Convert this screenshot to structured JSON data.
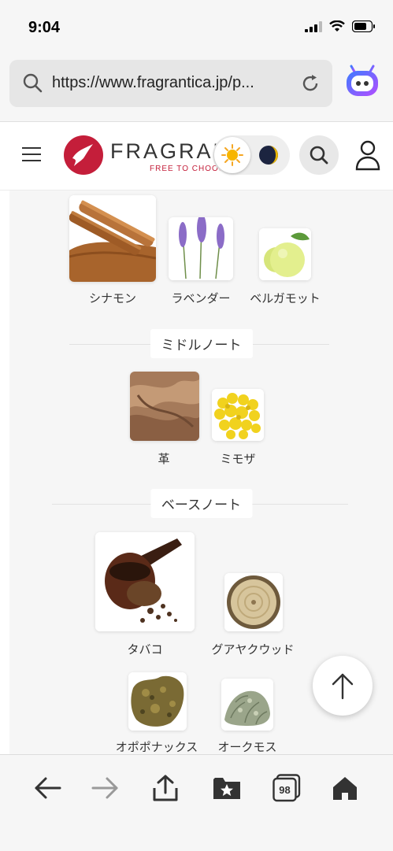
{
  "status_bar": {
    "time": "9:04"
  },
  "browser": {
    "url": "https://www.fragrantica.jp/p..."
  },
  "site": {
    "logo_text": "FRAGRANTICA",
    "tagline": "FREE TO CHOOSE"
  },
  "top_notes": [
    {
      "label": "シナモン",
      "icon": "cinnamon-image"
    },
    {
      "label": "ラベンダー",
      "icon": "lavender-image"
    },
    {
      "label": "ベルガモット",
      "icon": "bergamot-image"
    }
  ],
  "middle_notes": {
    "title": "ミドルノート",
    "items": [
      {
        "label": "革",
        "icon": "leather-image"
      },
      {
        "label": "ミモザ",
        "icon": "mimosa-image"
      }
    ]
  },
  "base_notes": {
    "title": "ベースノート",
    "items": [
      {
        "label": "タバコ",
        "icon": "tobacco-pipe-image"
      },
      {
        "label": "グアヤクウッド",
        "icon": "guaiac-wood-image"
      },
      {
        "label": "オポポナックス",
        "icon": "opoponax-image"
      },
      {
        "label": "オークモス",
        "icon": "oakmoss-image"
      }
    ]
  },
  "toolbar": {
    "tabs_count": "98"
  },
  "colors": {
    "brand_red": "#c41e3a",
    "assistant_purple": "#7b4dff"
  }
}
